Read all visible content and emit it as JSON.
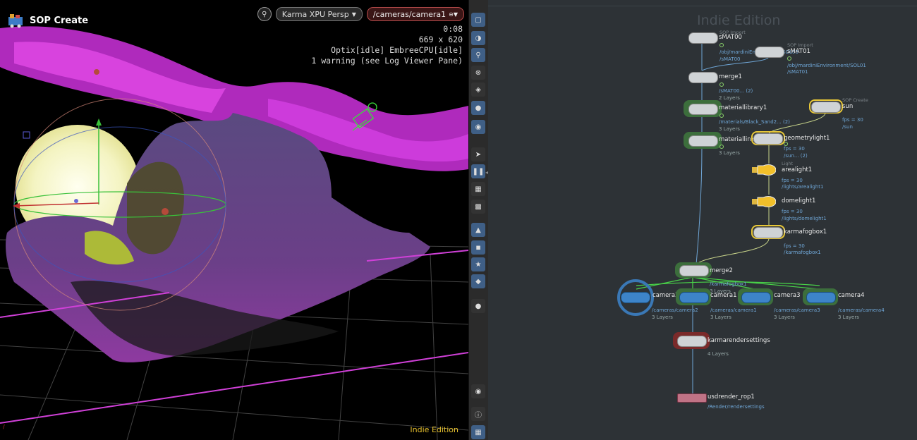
{
  "viewport": {
    "title": "SOP Create",
    "renderer_label": "Karma XPU",
    "view_mode": "Persp",
    "camera_path": "/cameras/camera1",
    "stats": [
      "0:08",
      "669 x 620",
      "Optix[idle] EmbreeCPU[idle]",
      "1 warning (see Log Viewer Pane)"
    ],
    "watermark": "Indie Edition",
    "lock_icon": "lock-icon"
  },
  "network": {
    "watermark": "Indie Edition",
    "nodes": {
      "smat00": {
        "name": "sMAT00",
        "type": "SOP Import",
        "sub": [
          "/obj/mardiniEnvironment/SOL00",
          "/sMAT00"
        ]
      },
      "smat01": {
        "name": "sMAT01",
        "type": "SOP Import",
        "sub": [
          "/obj/mardiniEnvironment/SOL01",
          "/sMAT01"
        ]
      },
      "merge1": {
        "name": "merge1",
        "sub": [
          "/sMAT00... (2)",
          "2 Layers"
        ]
      },
      "materiallibrary1": {
        "name": "materiallibrary1",
        "sub": [
          "/materials/Black_Sand2... (2)",
          "3 Layers"
        ]
      },
      "sun": {
        "name": "sun",
        "type": "SOP Create",
        "sub": [
          "fps = 30",
          "/sun"
        ]
      },
      "materiallinker": {
        "name": "materiallinke",
        "sub": [
          "3 Layers"
        ]
      },
      "geometrylight1": {
        "name": "geometrylight1",
        "sub": [
          "fps = 30",
          "/sun... (2)"
        ]
      },
      "arealight1": {
        "name": "arealight1",
        "type": "Light",
        "sub": [
          "fps = 30",
          "/lights/arealight1"
        ]
      },
      "domelight1": {
        "name": "domelight1",
        "sub": [
          "fps = 30",
          "/lights/domelight1"
        ]
      },
      "karmafogbox1": {
        "name": "karmafogbox1",
        "sub": [
          "fps = 30",
          "/karmafogbox1"
        ]
      },
      "merge2": {
        "name": "merge2",
        "sub": [
          "/karmafogbox1",
          "3 Layers"
        ]
      },
      "camera2": {
        "name": "camera2",
        "sub": [
          "/cameras/camera2",
          "3 Layers"
        ]
      },
      "camera1": {
        "name": "camera1",
        "sub": [
          "/cameras/camera1",
          "3 Layers"
        ]
      },
      "camera3": {
        "name": "camera3",
        "sub": [
          "/cameras/camera3",
          "3 Layers"
        ]
      },
      "camera4": {
        "name": "camera4",
        "sub": [
          "/cameras/camera4",
          "3 Layers"
        ]
      },
      "karmarendersettings": {
        "name": "karmarendersettings",
        "sub": [
          "4 Layers"
        ]
      },
      "usdrender_rop1": {
        "name": "usdrender_rop1",
        "sub": [
          "/Render/rendersettings"
        ]
      }
    }
  },
  "side_toolbar": {
    "icons": [
      "wireframe-icon",
      "ghost-icon",
      "lock-icon",
      "select-icon",
      "snap-icon",
      "light-icon",
      "camera-icon",
      "pointer-icon",
      "pause-icon",
      "layers-icon",
      "render-icon",
      "color-icon",
      "shading-icon",
      "flag-icon",
      "sphere-icon",
      "eye-icon",
      "info-icon",
      "grid-icon"
    ]
  }
}
